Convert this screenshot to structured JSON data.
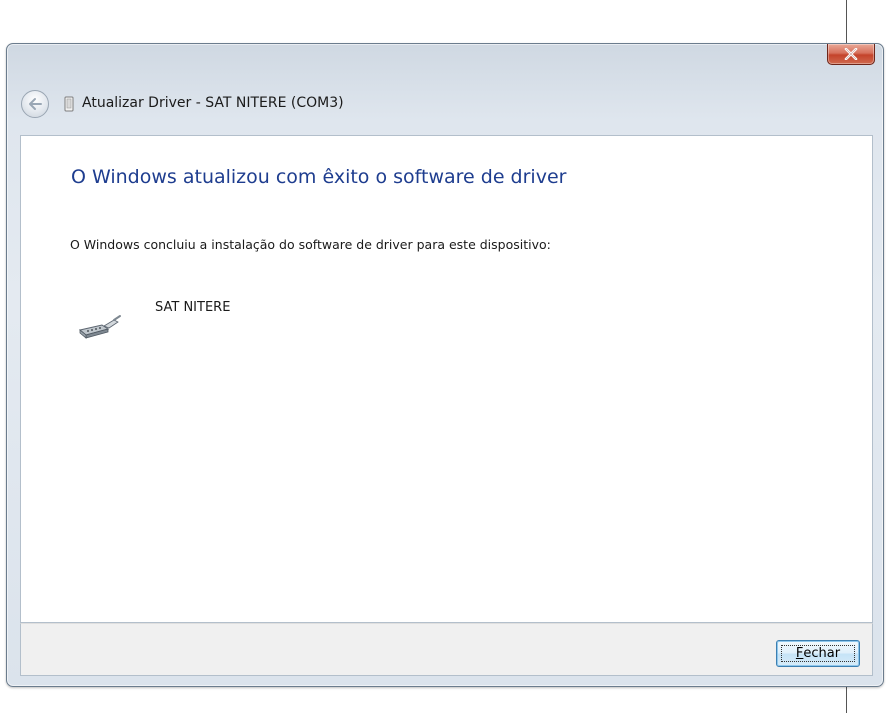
{
  "window": {
    "title": "Atualizar Driver -  SAT NITERE (COM3)",
    "close_icon": "close-x-icon"
  },
  "content": {
    "heading": "O Windows atualizou com êxito o software de driver",
    "description": "O Windows concluiu a instalação do software de driver para este dispositivo:",
    "device_name": "SAT NITERE",
    "device_icon": "serial-port-icon"
  },
  "footer": {
    "close_button_accel": "F",
    "close_button_rest": "echar"
  },
  "colors": {
    "heading": "#1e3d8f",
    "close_red": "#c4432b",
    "button_border": "#3c7fb1"
  }
}
